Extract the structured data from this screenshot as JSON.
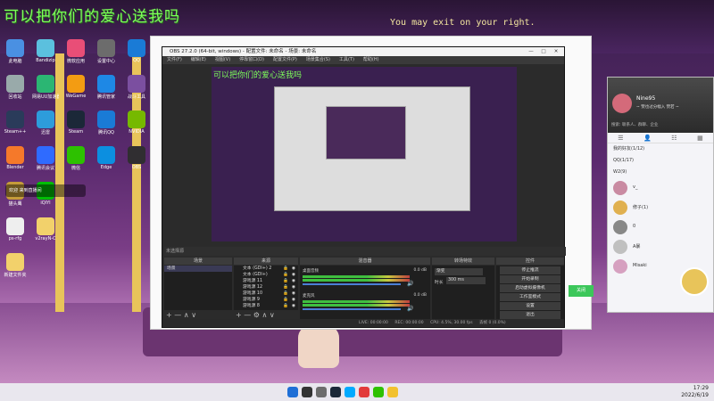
{
  "overlay_text": "可以把你们的爱心送我吗",
  "subtitle": "You may exit on your right.",
  "desktop_icons": [
    {
      "label": "此电脑",
      "color": "#4a90e2"
    },
    {
      "label": "Bandizip",
      "color": "#5bc0de"
    },
    {
      "label": "微软应用",
      "color": "#e94e77"
    },
    {
      "label": "设置中心",
      "color": "#6c6c6c"
    },
    {
      "label": "QQ",
      "color": "#1a7bd6"
    },
    {
      "label": "回收站",
      "color": "#9aa"
    },
    {
      "label": "网易UU加速器",
      "color": "#2bb673"
    },
    {
      "label": "WeGame",
      "color": "#f39c12"
    },
    {
      "label": "腾讯管家",
      "color": "#1e88e5"
    },
    {
      "label": "战斗工具",
      "color": "#7b4fa0"
    },
    {
      "label": "Steam++",
      "color": "#2a3b5a"
    },
    {
      "label": "迅雷",
      "color": "#2d9cdb"
    },
    {
      "label": "Steam",
      "color": "#1b2838"
    },
    {
      "label": "腾讯QQ",
      "color": "#1a7bd6"
    },
    {
      "label": "NVIDIA",
      "color": "#76b900"
    },
    {
      "label": "Blender",
      "color": "#f5792a"
    },
    {
      "label": "腾讯会议",
      "color": "#2f6bff"
    },
    {
      "label": "微信",
      "color": "#2dc100"
    },
    {
      "label": "Edge",
      "color": "#0c8fe0"
    },
    {
      "label": "OBS",
      "color": "#302e31"
    },
    {
      "label": "猫头鹰",
      "color": "#c59b3a"
    },
    {
      "label": "iQIYI",
      "color": "#00be06"
    },
    {
      "label": "ps-rfg",
      "color": "#eeeeee"
    },
    {
      "label": "v2rayN-C",
      "color": "#f2d16b"
    },
    {
      "label": "新建文件夹",
      "color": "#f2d16b"
    }
  ],
  "notify_text": "欢迎 来到直播间",
  "obs": {
    "title": "OBS 27.2.0 (64-bit, windows) - 配置文件: 未命名 - 场景: 未命名",
    "menu": [
      "文件(F)",
      "编辑(E)",
      "视图(V)",
      "停靠窗口(D)",
      "配置文件(P)",
      "场景集合(S)",
      "工具(T)",
      "帮助(H)"
    ],
    "preview_text": "可以把你们的爱心送我吗",
    "scene_panel": {
      "title": "场景",
      "items": [
        "场景"
      ]
    },
    "sources_panel": {
      "title": "来源",
      "items": [
        "文本 (GDI+) 2",
        "文本 (GDI+)",
        "游戏源 11",
        "游戏源 12",
        "游戏源 10",
        "游戏源 9",
        "游戏源 8"
      ]
    },
    "mixer": {
      "title": "混音器",
      "channels": [
        {
          "name": "桌面音频",
          "db": "0.0 dB"
        },
        {
          "name": "麦克风",
          "db": "0.0 dB"
        }
      ]
    },
    "transitions": {
      "title": "转场特效",
      "type": "渐变",
      "duration_label": "时长",
      "duration": "300 ms"
    },
    "controls": {
      "title": "控件",
      "buttons": [
        "停止推流",
        "开始录制",
        "启动虚拟摄像机",
        "工作室模式",
        "设置",
        "退出"
      ]
    },
    "status": {
      "live": "LIVE: 00:00:00",
      "rec": "REC: 00:00:00",
      "cpu": "CPU: 4.5%, 30.00 fps",
      "dropped": "丢帧 0 (0.0%)"
    },
    "no_source_label": "未选择源"
  },
  "qq": {
    "name": "Nine95",
    "status": "~ 赞也过分幅入 赞若 ~",
    "search": "搜索: 联系人、群聊、企业",
    "groups": [
      {
        "label": "我的好友(1/12)"
      },
      {
        "label": "QQ(1/17)"
      },
      {
        "label": "W2(9)"
      }
    ],
    "contacts": [
      {
        "name": "v_",
        "color": "#c98aa2"
      },
      {
        "name": "修子(1)",
        "color": "#e0b050"
      },
      {
        "name": "0",
        "color": "#888"
      },
      {
        "name": "A暴",
        "color": "#c0c0c0"
      },
      {
        "name": "Misaki",
        "color": "#d6a0c0"
      }
    ],
    "ok_label": "关闭"
  },
  "taskbar": {
    "time": "17:29",
    "date": "2022/6/19",
    "apps": [
      "#1f6fd6",
      "#333",
      "#6c6c6c",
      "#1b2838",
      "#00aaff",
      "#e23a3a",
      "#2dc100",
      "#f2c12e"
    ]
  }
}
